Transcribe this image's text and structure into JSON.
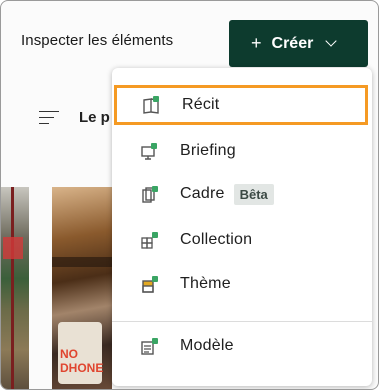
{
  "header": {
    "inspect_label": "Inspecter les éléments",
    "create": {
      "plus": "+",
      "label": "Créer"
    }
  },
  "content": {
    "sort_label": "Le p",
    "image2_text": "NO DHONE"
  },
  "menu": {
    "items": [
      {
        "label": "Récit",
        "icon": "story-icon",
        "selected": true
      },
      {
        "label": "Briefing",
        "icon": "briefing-icon"
      },
      {
        "label": "Cadre",
        "icon": "frame-icon",
        "badge": "Bêta"
      },
      {
        "label": "Collection",
        "icon": "collection-icon"
      },
      {
        "label": "Thème",
        "icon": "theme-icon"
      },
      {
        "label": "Modèle",
        "icon": "template-icon"
      }
    ]
  },
  "colors": {
    "create_bg": "#0d3b2e",
    "selected_outline": "#f59a23",
    "icon_green": "#3aa564"
  }
}
